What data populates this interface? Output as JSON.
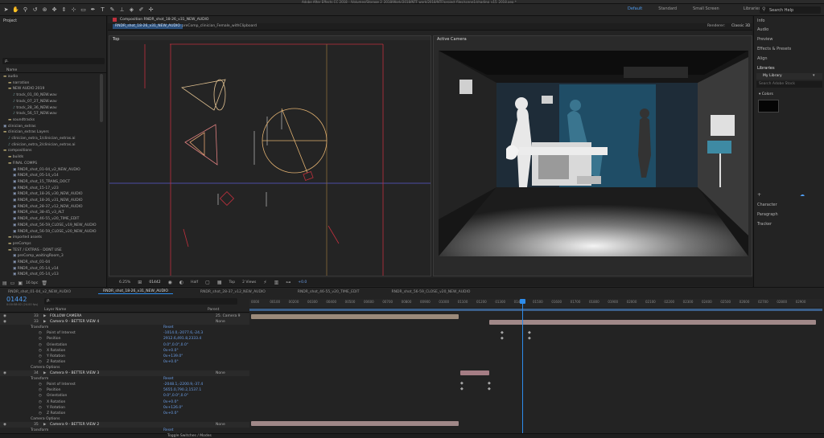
{
  "app": {
    "window_title": "Adobe After Effects CC 2018 - /Volumes/Storage 2_2018/Work/2018/NTF work/2018/NTF/project files/scene1/shading_v15_2018.aep *"
  },
  "toolbar": {
    "workspaces": [
      "Default",
      "Standard",
      "Small Screen",
      "Libraries"
    ],
    "active_workspace": "Default",
    "search_placeholder": "Search Help"
  },
  "project": {
    "title": "Project",
    "search_placeholder": "ρ.",
    "header": "Name",
    "items": [
      {
        "indent": 0,
        "icon": "folder",
        "label": "audio"
      },
      {
        "indent": 1,
        "icon": "folder",
        "label": "narration"
      },
      {
        "indent": 1,
        "icon": "folder",
        "label": "NEW AUDIO 2019"
      },
      {
        "indent": 2,
        "icon": "file",
        "label": "track_01_00_NEW.wav"
      },
      {
        "indent": 2,
        "icon": "file",
        "label": "track_07_27_NEW.wav"
      },
      {
        "indent": 2,
        "icon": "file",
        "label": "track_28_36_NEW.wav"
      },
      {
        "indent": 2,
        "icon": "file",
        "label": "track_56_57_NEW.wav"
      },
      {
        "indent": 1,
        "icon": "folder",
        "label": "soundtracks"
      },
      {
        "indent": 0,
        "icon": "comp",
        "label": "clinician_extras"
      },
      {
        "indent": 0,
        "icon": "folder",
        "label": "clinician_extras Layers"
      },
      {
        "indent": 1,
        "icon": "file",
        "label": "clinician_extra_1/clinician_extras.ai"
      },
      {
        "indent": 1,
        "icon": "file",
        "label": "clinician_extra_2/clinician_extras.ai"
      },
      {
        "indent": 0,
        "icon": "folder",
        "label": "compositions"
      },
      {
        "indent": 1,
        "icon": "folder",
        "label": "builds"
      },
      {
        "indent": 1,
        "icon": "folder",
        "label": "FINAL COMPS"
      },
      {
        "indent": 2,
        "icon": "comp",
        "label": "RNDR_shot_01-04_v2_NEW_AUDIO"
      },
      {
        "indent": 2,
        "icon": "comp",
        "label": "RNDR_shot_05-14_v14"
      },
      {
        "indent": 2,
        "icon": "comp",
        "label": "RNDR_shot_15_TRANS_DOCT"
      },
      {
        "indent": 2,
        "icon": "comp",
        "label": "RNDR_shot_15-17_v23"
      },
      {
        "indent": 2,
        "icon": "comp",
        "label": "RNDR_shot_18-26_v30_NEW_AUDIO"
      },
      {
        "indent": 2,
        "icon": "comp",
        "label": "RNDR_shot_18-26_v31_NEW_AUDIO"
      },
      {
        "indent": 2,
        "icon": "comp",
        "label": "RNDR_shot_28-37_v12_NEW_AUDIO"
      },
      {
        "indent": 2,
        "icon": "comp",
        "label": "RNDR_shot_38-45_v3_ALT"
      },
      {
        "indent": 2,
        "icon": "comp",
        "label": "RNDR_shot_46-55_v20_TIME_EDIT"
      },
      {
        "indent": 2,
        "icon": "comp",
        "label": "RNDR_shot_56-59_CLOSE_v19_NEW_AUDIO"
      },
      {
        "indent": 2,
        "icon": "comp",
        "label": "RNDR_shot_56-59_CLOSE_v20_NEW_AUDIO"
      },
      {
        "indent": 1,
        "icon": "folder",
        "label": "imported assets"
      },
      {
        "indent": 1,
        "icon": "folder",
        "label": "preComps"
      },
      {
        "indent": 1,
        "icon": "folder",
        "label": "TEST / EXTRAS - DONT USE"
      },
      {
        "indent": 2,
        "icon": "comp",
        "label": "preComp_waitingRoom_3"
      },
      {
        "indent": 2,
        "icon": "comp",
        "label": "RNDR_shot_01-04"
      },
      {
        "indent": 2,
        "icon": "comp",
        "label": "RNDR_shot_05-14_v14"
      },
      {
        "indent": 2,
        "icon": "comp",
        "label": "RNDR_shot_05-14_v13"
      }
    ],
    "footer_bpc": "16 bpc"
  },
  "viewer": {
    "panel_title": "Composition RNDR_shot_18-26_v31_NEW_AUDIO",
    "breadcrumb": [
      "RNDR_shot_18-26_v31_NEW_AUDIO",
      "preComp_clinician_Female_withClipboard"
    ],
    "renderer_label": "Renderer:",
    "renderer_value": "Classic 3D",
    "left_view_label": "Top",
    "right_view_label": "Active Camera",
    "zoom": "6.25%",
    "timecode": "01442",
    "resolution": "Half",
    "view": "Top",
    "views_count": "2 Views",
    "offset": "+0.0"
  },
  "right_panel": {
    "items": [
      "Info",
      "Audio",
      "Preview",
      "Effects & Presets",
      "Align",
      "Libraries"
    ],
    "library_name": "My Library",
    "search_placeholder": "Search Adobe Stock",
    "section": "Colors",
    "lower_items": [
      "Character",
      "Paragraph",
      "Tracker"
    ]
  },
  "timeline": {
    "tabs": [
      "RNDR_shot_01-04_v2_NEW_AUDIO",
      "RNDR_shot_18-26_v31_NEW_AUDIO",
      "RNDR_shot_28-37_v12_NEW_AUDIO",
      "RNDR_shot_46-55_v20_TIME_EDIT",
      "RNDR_shot_56-59_CLOSE_v20_NEW_AUDIO"
    ],
    "active_tab": 1,
    "timecode": "01442",
    "fps": "0:00:58:02 (24.00 fps)",
    "col_layer_name": "Layer Name",
    "col_parent": "Parent",
    "ruler": [
      "0000",
      "00100",
      "00200",
      "00300",
      "00400",
      "00500",
      "00600",
      "00700",
      "00800",
      "00900",
      "01000",
      "01100",
      "01200",
      "01300",
      "01400",
      "01500",
      "01600",
      "01700",
      "01800",
      "01900",
      "02000",
      "02100",
      "02200",
      "02300",
      "02400",
      "02500",
      "02600",
      "02700",
      "02800",
      "02900"
    ],
    "rows": [
      {
        "type": "layer",
        "num": "33",
        "name": "FOLLOW CAMERA",
        "parent": "25. Camera 9"
      },
      {
        "type": "layer",
        "num": "33",
        "name": "Camera 9 - BETTER VIEW 4",
        "parent": "None"
      },
      {
        "type": "group",
        "name": "Transform",
        "value": "Reset"
      },
      {
        "type": "prop",
        "name": "Point of Interest",
        "value": "-1014.0,-2077.6,-24.3"
      },
      {
        "type": "prop",
        "name": "Position",
        "value": "2912.6,491.8,2333.4"
      },
      {
        "type": "prop",
        "name": "Orientation",
        "value": "0.0°,0.0°,0.0°"
      },
      {
        "type": "prop",
        "name": "X Rotation",
        "value": "0x+0.0°"
      },
      {
        "type": "prop",
        "name": "Y Rotation",
        "value": "0x+139.0°"
      },
      {
        "type": "prop",
        "name": "Z Rotation",
        "value": "0x+0.0°"
      },
      {
        "type": "group",
        "name": "Camera Options",
        "value": ""
      },
      {
        "type": "layer",
        "num": "34",
        "name": "Camera 9 - BETTER VIEW 3",
        "parent": "None"
      },
      {
        "type": "group",
        "name": "Transform",
        "value": "Reset"
      },
      {
        "type": "prop",
        "name": "Point of Interest",
        "value": "-2048.1,-2200.9,-37.4"
      },
      {
        "type": "prop",
        "name": "Position",
        "value": "5655.0,790.2,1537.1"
      },
      {
        "type": "prop",
        "name": "Orientation",
        "value": "0.0°,0.0°,0.0°"
      },
      {
        "type": "prop",
        "name": "X Rotation",
        "value": "0x+0.0°"
      },
      {
        "type": "prop",
        "name": "Y Rotation",
        "value": "0x+126.0°"
      },
      {
        "type": "prop",
        "name": "Z Rotation",
        "value": "0x+0.0°"
      },
      {
        "type": "group",
        "name": "Camera Options",
        "value": ""
      },
      {
        "type": "layer",
        "num": "35",
        "name": "Camera 9 - BETTER VIEW 2",
        "parent": "None"
      },
      {
        "type": "group",
        "name": "Transform",
        "value": "Reset"
      }
    ],
    "footer_label": "Toggle Switches / Modes"
  },
  "colors": {
    "accent": "#2d8ceb",
    "composition_red": "#c0303d",
    "layer_bar_tan": "#9b8a7a",
    "layer_bar_pink": "#a08888",
    "layer_bar_rose": "#a57d84"
  }
}
